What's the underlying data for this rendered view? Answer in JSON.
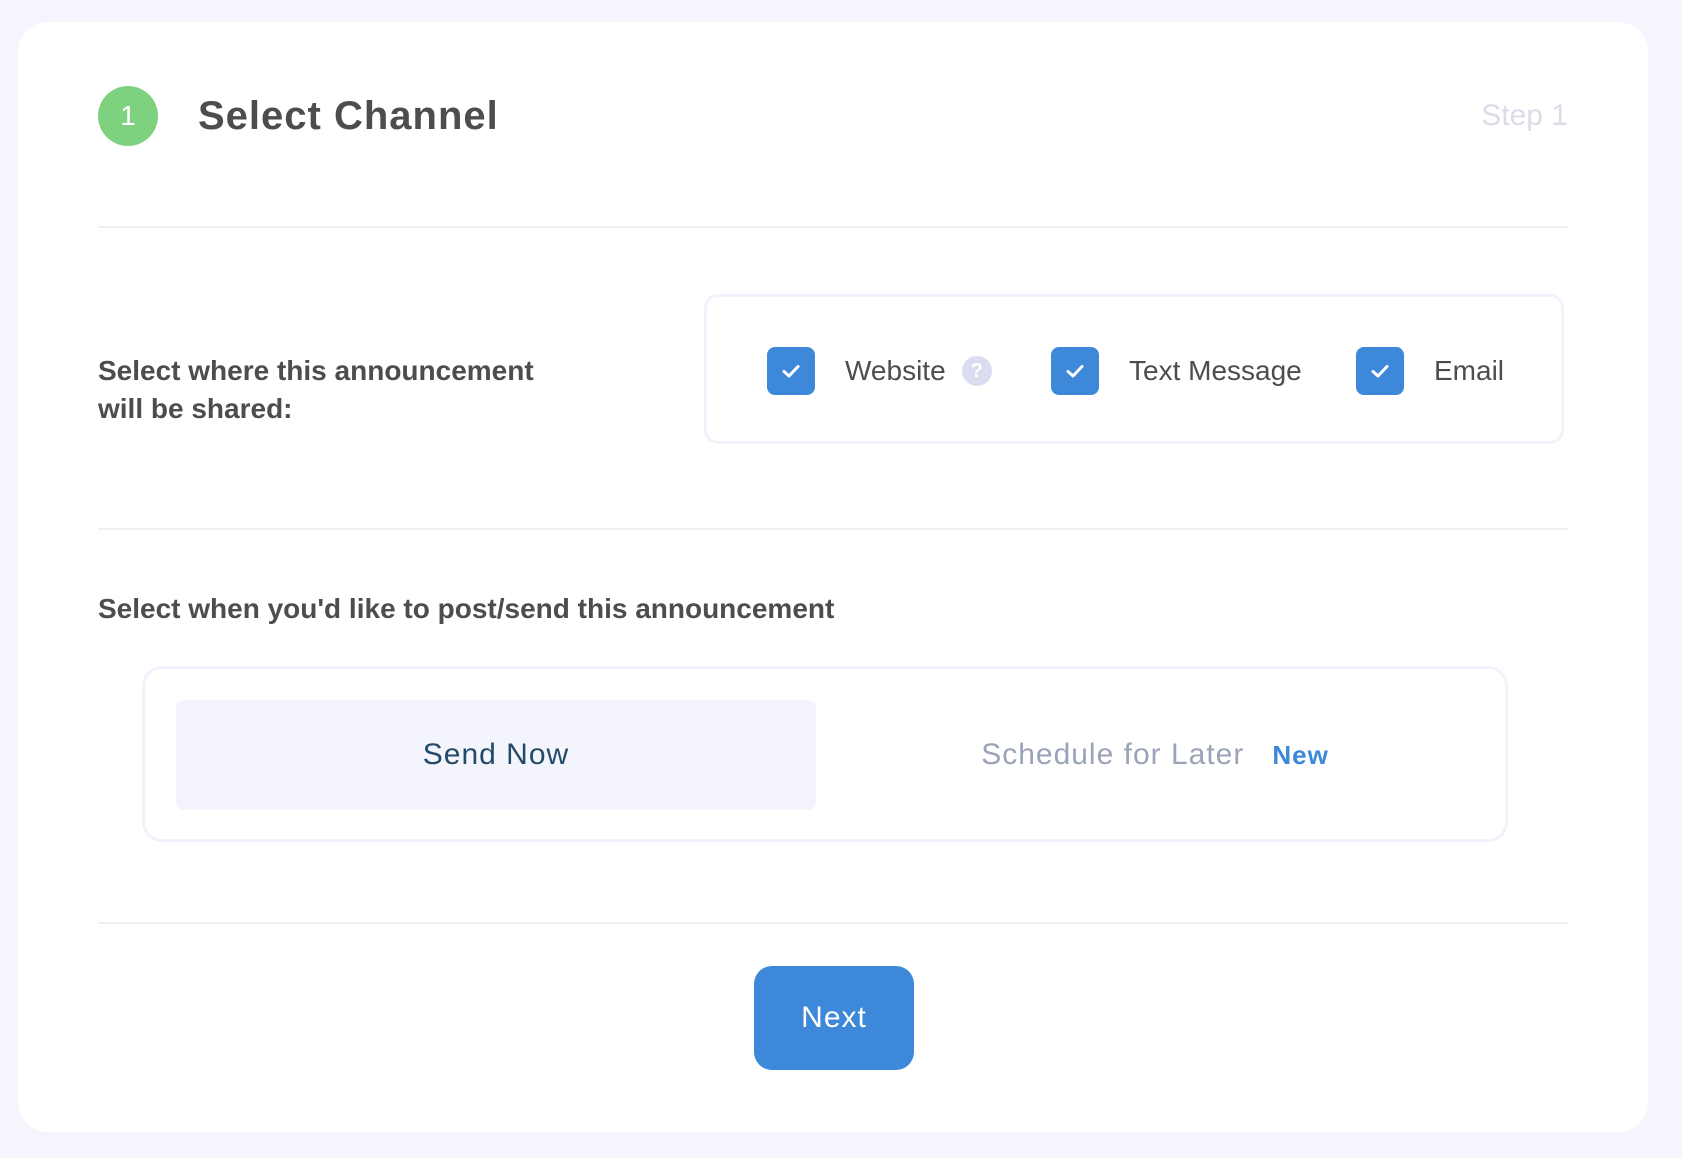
{
  "header": {
    "step_number": "1",
    "title": "Select Channel",
    "step_label": "Step 1"
  },
  "channel_section": {
    "label": "Select where this announcement will be shared:",
    "options": [
      {
        "label": "Website",
        "checked": true,
        "has_help": true,
        "help_icon": "question-mark"
      },
      {
        "label": "Text Message",
        "checked": true
      },
      {
        "label": "Email",
        "checked": true
      }
    ]
  },
  "timing_section": {
    "label": "Select when you'd like to post/send this announcement",
    "send_now_label": "Send Now",
    "schedule_later_label": "Schedule for Later",
    "new_badge": "New",
    "selected": "Send Now"
  },
  "footer": {
    "next_label": "Next"
  },
  "colors": {
    "accent": "#3d88d8",
    "step_badge": "#7ed17f",
    "background": "#f5f6fd"
  }
}
